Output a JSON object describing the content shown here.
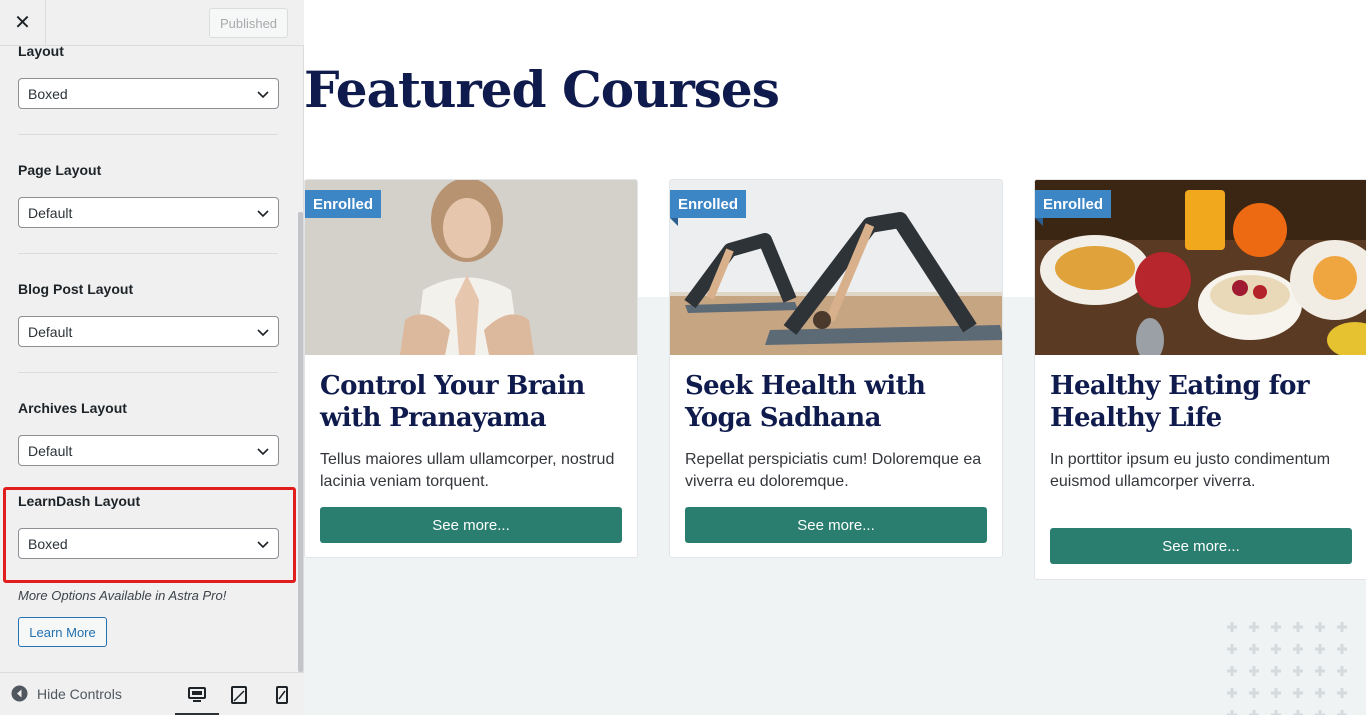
{
  "sidebar": {
    "close_label": "✕",
    "publish_label": "Published",
    "sections": [
      {
        "label": "Layout",
        "value": "Boxed"
      },
      {
        "label": "Page Layout",
        "value": "Default"
      },
      {
        "label": "Blog Post Layout",
        "value": "Default"
      },
      {
        "label": "Archives Layout",
        "value": "Default"
      },
      {
        "label": "LearnDash Layout",
        "value": "Boxed"
      }
    ],
    "more_options": "More Options Available in Astra Pro!",
    "learn_more": "Learn More",
    "footer": {
      "hide_controls": "Hide Controls",
      "active_device": "desktop"
    }
  },
  "preview": {
    "section_title": "Featured Courses",
    "courses": [
      {
        "badge": "Enrolled",
        "title": "Control Your Brain with Pranayama",
        "text": "Tellus maiores ullam ullamcorper, nostrud lacinia veniam torquent.",
        "button": "See more..."
      },
      {
        "badge": "Enrolled",
        "title": "Seek Health with Yoga Sadhana",
        "text": "Repellat perspiciatis cum! Doloremque ea viverra eu doloremque.",
        "button": "See more..."
      },
      {
        "badge": "Enrolled",
        "title": "Healthy Eating for Healthy Life",
        "text": "In porttitor ipsum eu justo condimentum euismod ullamcorper viverra.",
        "button": "See more..."
      }
    ]
  },
  "colors": {
    "title_navy": "#0f1b4c",
    "button_teal": "#2a7e6f",
    "badge_blue": "#3d86c6",
    "highlight_red": "#e11d1d"
  }
}
